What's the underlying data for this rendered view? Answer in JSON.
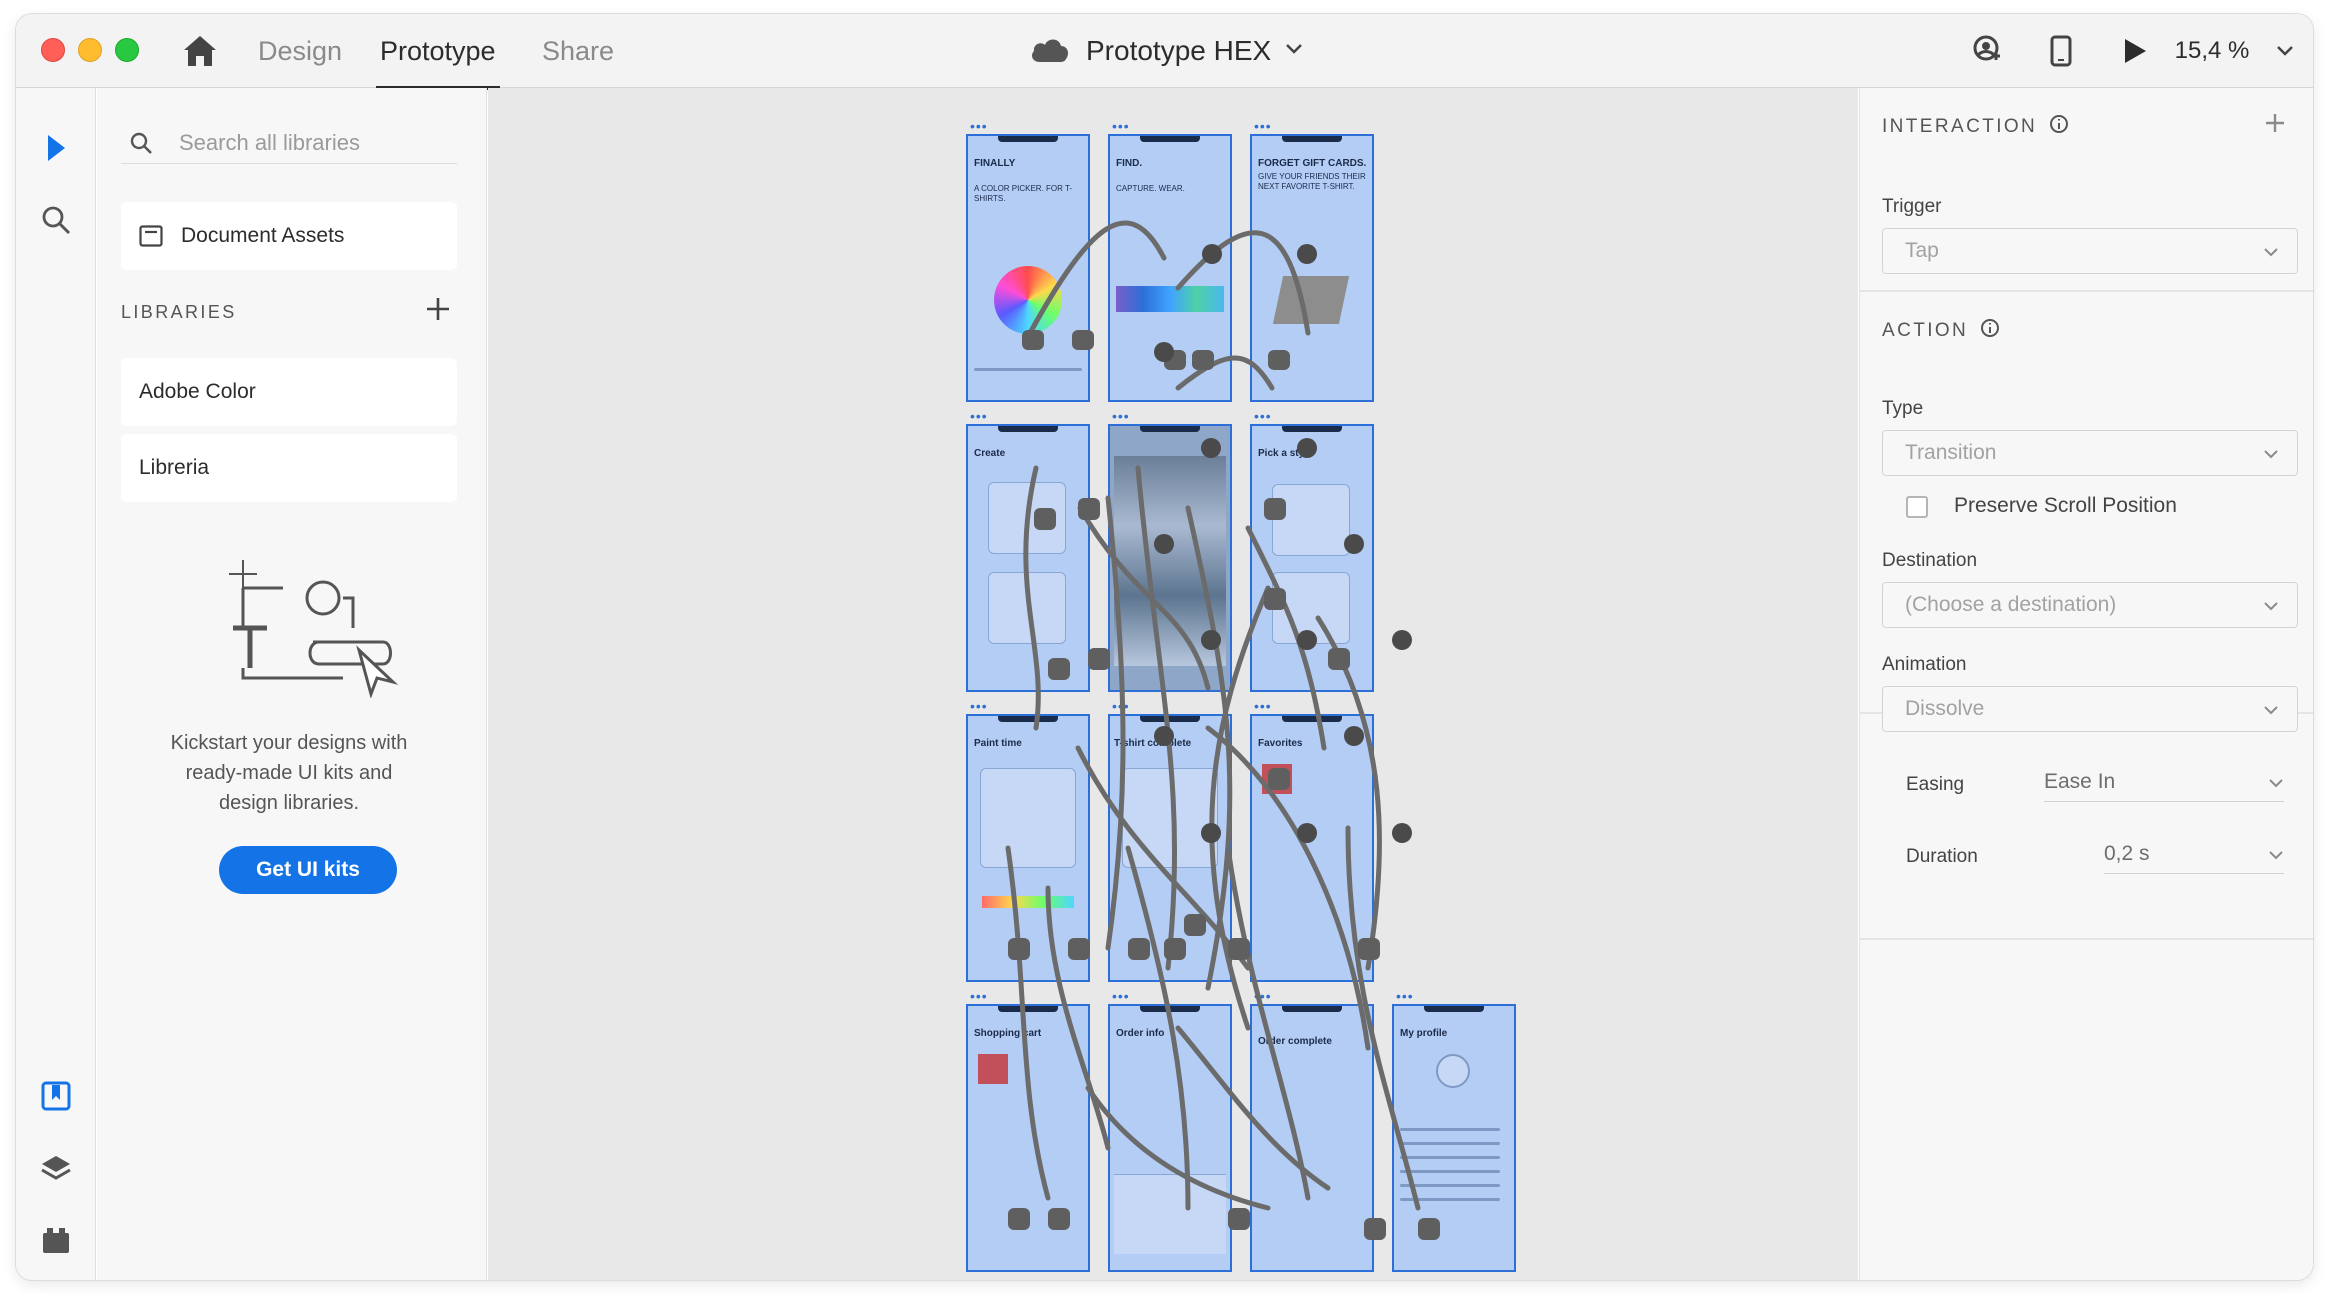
{
  "titlebar": {
    "tabs": [
      "Design",
      "Prototype",
      "Share"
    ],
    "active_tab": "Prototype",
    "document_title": "Prototype HEX",
    "zoom": "15,4 %"
  },
  "libraries_panel": {
    "search_placeholder": "Search all libraries",
    "document_assets": "Document Assets",
    "section_title": "LIBRARIES",
    "libraries": [
      "Adobe Color",
      "Libreria"
    ],
    "empty_state_text_1": "Kickstart your designs with",
    "empty_state_text_2": "ready-made UI kits and",
    "empty_state_text_3": "design libraries.",
    "cta_label": "Get UI kits"
  },
  "canvas": {
    "artboards": [
      {
        "title": "FINALLY",
        "subtitle": "A COLOR PICKER. FOR T-SHIRTS."
      },
      {
        "title": "FIND.",
        "subtitle": "CAPTURE. WEAR."
      },
      {
        "title": "FORGET GIFT CARDS.",
        "subtitle": "GIVE YOUR FRIENDS THEIR NEXT FAVORITE T-SHIRT."
      },
      {
        "title": "Create",
        "subtitle": ""
      },
      {
        "title": "",
        "subtitle": ""
      },
      {
        "title": "Pick a style",
        "subtitle": ""
      },
      {
        "title": "Paint time",
        "subtitle": ""
      },
      {
        "title": "T-shirt complete",
        "subtitle": ""
      },
      {
        "title": "Favorites",
        "subtitle": ""
      },
      {
        "title": "Shopping cart",
        "subtitle": ""
      },
      {
        "title": "Order info",
        "subtitle": ""
      },
      {
        "title": "Order complete",
        "subtitle": ""
      },
      {
        "title": "My profile",
        "subtitle": ""
      }
    ]
  },
  "inspector": {
    "interaction": {
      "heading": "INTERACTION",
      "trigger_label": "Trigger",
      "trigger_value": "Tap"
    },
    "action": {
      "heading": "ACTION",
      "type_label": "Type",
      "type_value": "Transition",
      "preserve_scroll": "Preserve Scroll Position",
      "preserve_scroll_checked": false,
      "destination_label": "Destination",
      "destination_value": "(Choose a destination)",
      "animation_label": "Animation",
      "animation_value": "Dissolve",
      "easing_label": "Easing",
      "easing_value": "Ease In",
      "duration_label": "Duration",
      "duration_value": "0,2 s"
    }
  },
  "colors": {
    "accent": "#1473e6",
    "artboard_fill": "#b4cdf4",
    "artboard_outline": "#2d6fd8",
    "wire": "#6b6b6b",
    "traffic_red": "#ff5f57",
    "traffic_yellow": "#febc2e",
    "traffic_green": "#28c840"
  }
}
